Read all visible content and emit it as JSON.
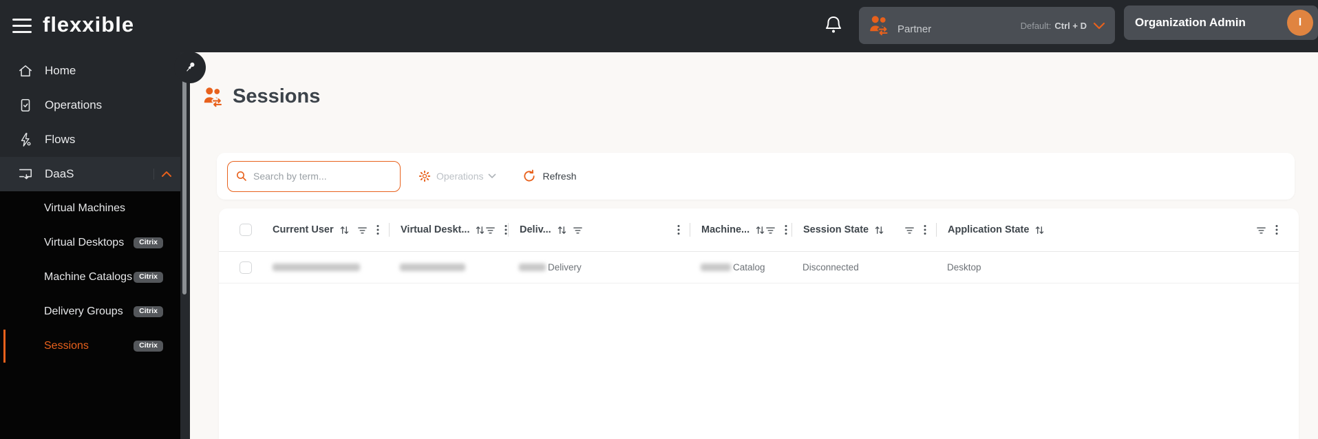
{
  "colors": {
    "accent": "#E8611C",
    "header_bg": "#24272B",
    "submenu_bg": "#050505",
    "avatar_bg": "#E08440",
    "active_text": "#E8611C"
  },
  "brand": {
    "logo_text": "flexxible"
  },
  "topbar": {
    "partner_button": {
      "label": "Partner",
      "shortcut_prefix": "Default:",
      "shortcut": "Ctrl + D"
    },
    "org_button": {
      "label": "Organization Admin",
      "avatar_letter": "I"
    }
  },
  "sidebar": {
    "items": [
      {
        "label": "Home"
      },
      {
        "label": "Operations"
      },
      {
        "label": "Flows"
      },
      {
        "label": "DaaS"
      }
    ],
    "daas_children": [
      {
        "label": "Virtual Machines"
      },
      {
        "label": "Virtual Desktops",
        "badge": "Citrix"
      },
      {
        "label": "Machine Catalogs",
        "badge": "Citrix"
      },
      {
        "label": "Delivery Groups",
        "badge": "Citrix"
      },
      {
        "label": "Sessions",
        "badge": "Citrix",
        "active": true
      }
    ]
  },
  "main": {
    "title": "Sessions",
    "toolbar": {
      "search_placeholder": "Search by term...",
      "operations_label": "Operations",
      "refresh_label": "Refresh"
    },
    "table": {
      "columns": [
        {
          "label": "Current User"
        },
        {
          "label": "Virtual Deskt..."
        },
        {
          "label": "Deliv..."
        },
        {
          "label": "Machine..."
        },
        {
          "label": "Session State"
        },
        {
          "label": "Application State"
        }
      ],
      "rows": [
        {
          "current_user_redacted": true,
          "virtual_desktop_redacted": true,
          "delivery_group": "Delivery",
          "machine_catalog": "Catalog",
          "session_state": "Disconnected",
          "application_state": "Desktop"
        }
      ]
    }
  }
}
